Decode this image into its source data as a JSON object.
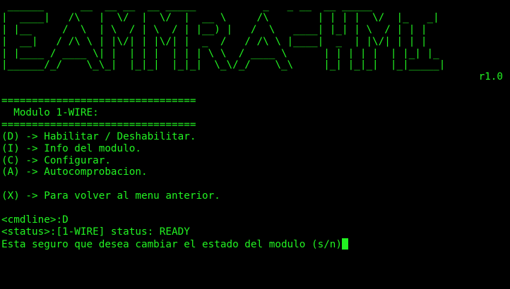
{
  "banner": {
    "lines": [
      " ______      __  __ __  __ _____           _   _ __  __ _____ ",
      "|  ____|   /\\   |  \\/  |  \\/  |  __ \\     /\\        | | | |  \\/  |_   _|",
      "| |__     /  \\  | \\  / | \\  / | |__) |   /  \\   ____| |_| | \\  / | | |  ",
      "|  __|   / /\\ \\ | |\\/| | |\\/| |  _  /   / /\\ \\ |____|  _  | |\\/| | | |  ",
      "| |____ / ____ \\| |  | | |  | | | \\ \\  / ____ \\      | | | | |  | |_| |_ ",
      "|______/_/    \\_\\_|  |_|_|  |_|_|  \\_\\/_/    \\_\\     |_| |_|_|  |_|_____|"
    ],
    "version": "r1.0"
  },
  "menu": {
    "separator_top": "================================",
    "title": "  Modulo 1-WIRE:",
    "separator_bottom": "================================",
    "options": [
      "(D) -> Habilitar / Deshabilitar.",
      "(I) -> Info del modulo.",
      "(C) -> Configurar.",
      "(A) -> Autocomprobacion."
    ],
    "back_option": "(X) -> Para volver al menu anterior."
  },
  "console": {
    "cmdline": "<cmdline>:D",
    "status": "<status>:[1-WIRE] status: READY",
    "prompt": "Esta seguro que desea cambiar el estado del modulo (s/n)"
  },
  "colors": {
    "background": "#000000",
    "foreground": "#22f222"
  }
}
